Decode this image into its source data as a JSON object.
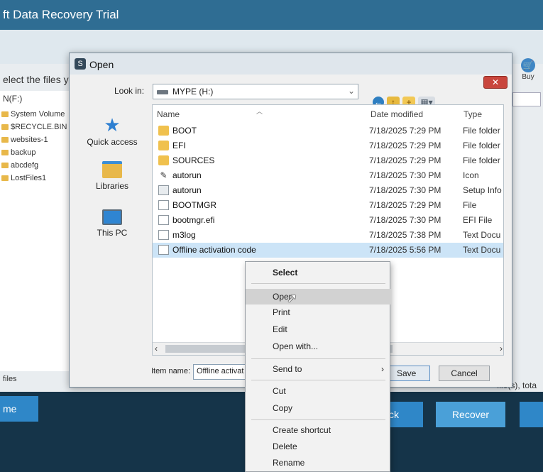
{
  "background_app": {
    "title": "ft Data Recovery Trial",
    "buy_label": "Buy",
    "prompt": "elect the files y",
    "drive": "N(F:)",
    "tree_items": [
      "System Volume",
      "$RECYCLE.BIN",
      "websites-1",
      "backup",
      "abcdefg",
      "LostFiles1"
    ],
    "files_label": "files",
    "status_text": "file(s), tota",
    "buttons": {
      "home": "me",
      "back": "ck",
      "recover": "Recover"
    }
  },
  "dialog": {
    "title": "Open",
    "close_label": "✕",
    "look_in_label": "Look in:",
    "look_in_value": "MYPE (H:)",
    "places": [
      {
        "label": "Quick access",
        "icon": "star-icon"
      },
      {
        "label": "Libraries",
        "icon": "libraries-icon"
      },
      {
        "label": "This PC",
        "icon": "computer-icon"
      }
    ],
    "columns": {
      "name": "Name",
      "date": "Date modified",
      "type": "Type"
    },
    "files": [
      {
        "name": "BOOT",
        "date": "7/18/2025 7:29 PM",
        "type": "File folder",
        "icon": "folder-icon"
      },
      {
        "name": "EFI",
        "date": "7/18/2025 7:29 PM",
        "type": "File folder",
        "icon": "folder-icon"
      },
      {
        "name": "SOURCES",
        "date": "7/18/2025 7:29 PM",
        "type": "File folder",
        "icon": "folder-icon"
      },
      {
        "name": "autorun",
        "date": "7/18/2025 7:30 PM",
        "type": "Icon",
        "icon": "shortcut-icon"
      },
      {
        "name": "autorun",
        "date": "7/18/2025 7:30 PM",
        "type": "Setup Info",
        "icon": "settings-file-icon"
      },
      {
        "name": "BOOTMGR",
        "date": "7/18/2025 7:29 PM",
        "type": "File",
        "icon": "file-icon"
      },
      {
        "name": "bootmgr.efi",
        "date": "7/18/2025 7:30 PM",
        "type": "EFI File",
        "icon": "file-icon"
      },
      {
        "name": "m3log",
        "date": "7/18/2025 7:38 PM",
        "type": "Text Docu",
        "icon": "text-file-icon"
      },
      {
        "name": "Offline activation code",
        "date": "7/18/2025 5:56 PM",
        "type": "Text Docu",
        "icon": "text-file-icon",
        "selected": true
      }
    ],
    "item_name_label": "Item name:",
    "item_name_value": "Offline activat",
    "save_label": "Save",
    "cancel_label": "Cancel"
  },
  "context_menu": {
    "header": "Select",
    "items": [
      "Open",
      "Print",
      "Edit",
      "Open with...",
      "Send to",
      "Cut",
      "Copy",
      "Create shortcut",
      "Delete",
      "Rename"
    ],
    "hovered": "Open"
  }
}
